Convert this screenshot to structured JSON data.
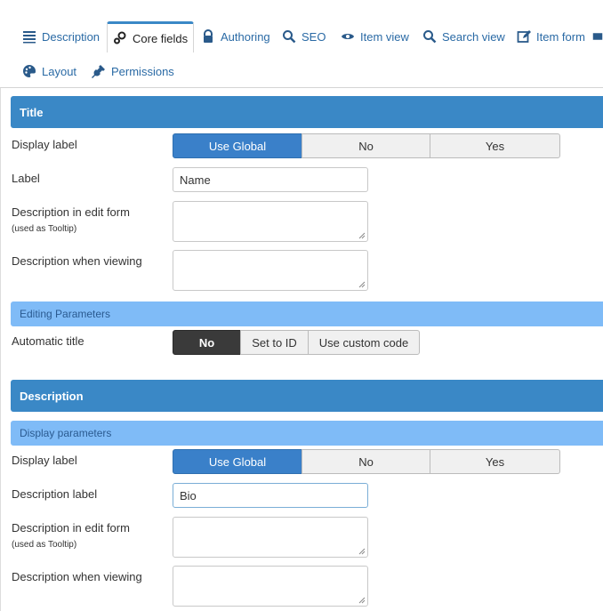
{
  "tabs": [
    {
      "label": "Description",
      "icon": "list-icon"
    },
    {
      "label": "Core fields",
      "icon": "gears-icon",
      "active": true
    },
    {
      "label": "Authoring",
      "icon": "lock-icon"
    },
    {
      "label": "SEO",
      "icon": "search-icon"
    },
    {
      "label": "Item view",
      "icon": "eye-icon"
    },
    {
      "label": "Search view",
      "icon": "search-icon"
    },
    {
      "label": "Item form",
      "icon": "edit-icon"
    },
    {
      "label": "Layout",
      "icon": "palette-icon"
    },
    {
      "label": "Permissions",
      "icon": "plug-icon"
    }
  ],
  "title_section": {
    "header": "Title",
    "display_label": {
      "label": "Display label",
      "options": [
        "Use Global",
        "No",
        "Yes"
      ],
      "selected": "Use Global"
    },
    "label_field": {
      "label": "Label",
      "value": "Name"
    },
    "desc_edit": {
      "label": "Description in edit form",
      "hint": "(used as Tooltip)"
    },
    "desc_view": {
      "label": "Description when viewing"
    },
    "editing_params": "Editing Parameters",
    "automatic_title": {
      "label": "Automatic title",
      "options": [
        "No",
        "Set to ID",
        "Use custom code"
      ],
      "selected": "No"
    }
  },
  "description_section": {
    "header": "Description",
    "display_params": "Display parameters",
    "display_label": {
      "label": "Display label",
      "options": [
        "Use Global",
        "No",
        "Yes"
      ],
      "selected": "Use Global"
    },
    "desc_label": {
      "label": "Description label",
      "value": "Bio"
    },
    "desc_edit": {
      "label": "Description in edit form",
      "hint": "(used as Tooltip)"
    },
    "desc_view": {
      "label": "Description when viewing"
    }
  },
  "colors": {
    "accent": "#3a88c6",
    "subheader": "#7fbbf7",
    "tab_link": "#2a6aa5",
    "selected_dark": "#3a3a3a"
  }
}
